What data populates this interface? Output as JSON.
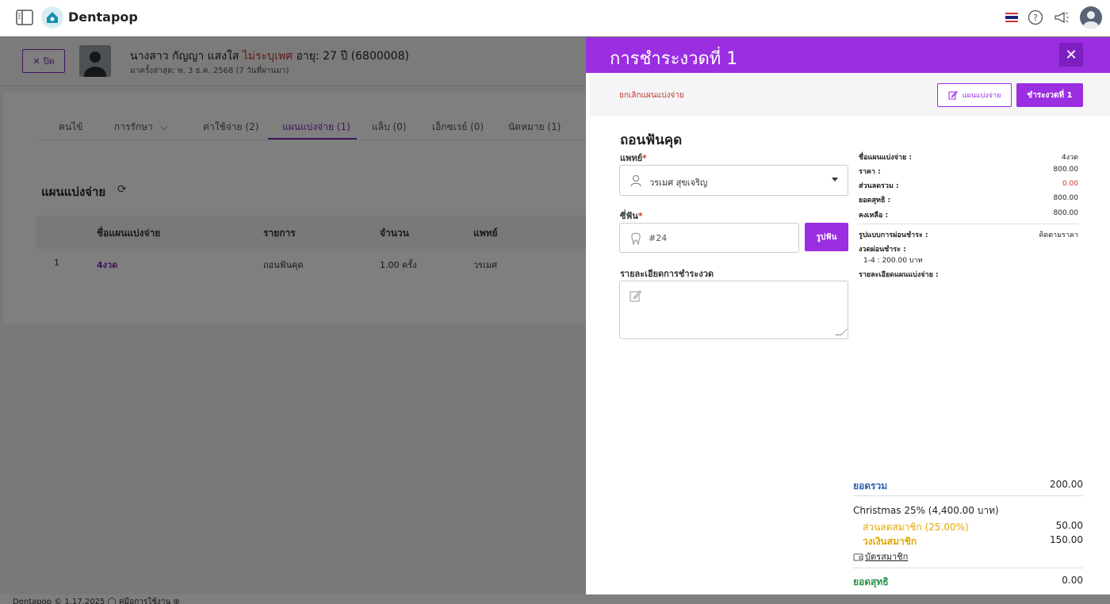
{
  "app": {
    "name": "Dentapop"
  },
  "patient": {
    "close_label": "ปิด",
    "name": "นางสาว กัญญา แสงใส",
    "gender": "ไม่ระบุเพศ",
    "age_id": "อายุ: 27 ปี  (6800008)",
    "last_visit": "มาครั้งล่าสุด: พ. 3 ธ.ค. 2568 (7 วันที่ผ่านมา)"
  },
  "tabs": [
    {
      "label": "คนไข้"
    },
    {
      "label": "การรักษา"
    },
    {
      "label": "ค่าใช้จ่าย (2)"
    },
    {
      "label": "แผนแบ่งจ่าย (1)"
    },
    {
      "label": "แล็บ (0)"
    },
    {
      "label": "เอ็กซเรย์ (0)"
    },
    {
      "label": "นัดหมาย (1)"
    }
  ],
  "plans": {
    "title": "แผนแบ่งจ่าย",
    "columns": [
      "ชื่อแผนแบ่งจ่าย",
      "รายการ",
      "จำนวน",
      "แพทย์"
    ],
    "rows": [
      {
        "no": "1",
        "name": "4งวด",
        "item": "ถอนฟันคุด",
        "qty": "1.00 ครั้ง",
        "doctor": "วรเมศ"
      }
    ]
  },
  "footer": {
    "text": "Dentapop © 1.17.2025    ◯ คู่มือการใช้งาน ⊕"
  },
  "drawer": {
    "title": "การชำระงวดที่ 1",
    "cancel_label": "ยกเลิกแผนแบ่งจ่าย",
    "plan_button": "แผนแบ่งจ่าย",
    "pay_button": "ชำระงวดที่ 1",
    "procedure": "ถอนฟันคุด",
    "doctor_label": "แพทย์",
    "doctor_value": "วรเมศ สุขเจริญ",
    "tooth_label": "ซี่ฟัน",
    "tooth_value": "#24",
    "tooth_button": "รูปฟัน",
    "detail_label": "รายละเอียดการชำระงวด",
    "info": {
      "plan_name_k": "ชื่อแผนแบ่งจ่าย :",
      "plan_name_v": "4งวด",
      "price_k": "ราคา :",
      "price_v": "800.00",
      "discount_k": "ส่วนลดรวม :",
      "discount_v": "0.00",
      "net_k": "ยอดสุทธิ :",
      "net_v": "800.00",
      "remain_k": "คงเหลือ :",
      "remain_v": "800.00",
      "pattern_k": "รูปแบบการผ่อนชำระ :",
      "pattern_v": "คิดตามราคา",
      "installments_k": "งวดผ่อนชำระ :",
      "installments_v": "1-4 :  200.00 บาท",
      "plan_detail_k": "รายละเอียดแผนแบ่งจ่าย :"
    },
    "summary": {
      "total_k": "ยอดรวม",
      "total_v": "200.00",
      "promo": "Christmas 25% (4,400.00 บาท)",
      "member_discount_k": "ส่วนลดสมาชิก (25.00%)",
      "member_discount_v": "50.00",
      "member_credit_k": "วงเงินสมาชิก",
      "member_credit_v": "150.00",
      "member_card": "บัตรสมาชิก",
      "net_k": "ยอดสุทธิ",
      "net_v": "0.00"
    }
  },
  "colors": {
    "accent": "#9b2ee0",
    "danger": "#c0392b",
    "blue": "#2f5fb3",
    "gold": "#e0a800",
    "green": "#27944a"
  }
}
